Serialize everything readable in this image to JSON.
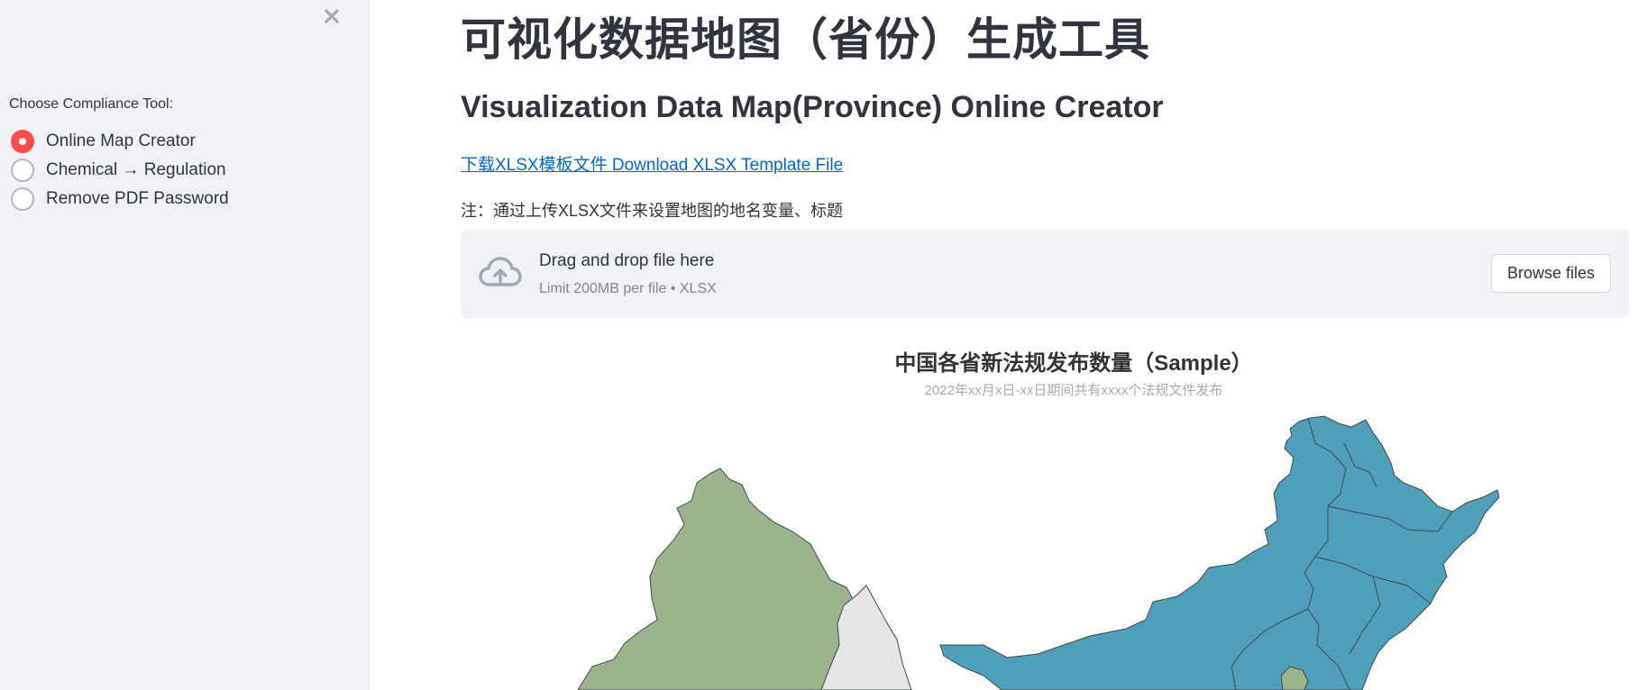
{
  "sidebar": {
    "radio_label": "Choose Compliance Tool:",
    "options": [
      {
        "label": "Online Map Creator",
        "selected": true
      },
      {
        "label": "Chemical → Regulation",
        "selected": false
      },
      {
        "label": "Remove PDF Password",
        "selected": false
      }
    ]
  },
  "main": {
    "title_cn": "可视化数据地图（省份）生成工具",
    "title_en": "Visualization Data Map(Province) Online Creator",
    "download_link": "下载XLSX模板文件 Download XLSX Template File",
    "note": "注：通过上传XLSX文件来设置地图的地名变量、标题",
    "uploader": {
      "title": "Drag and drop file here",
      "limit": "Limit 200MB per file • XLSX",
      "browse_label": "Browse files"
    },
    "chart": {
      "title": "中国各省新法规发布数量（Sample）",
      "subtitle": "2022年xx月x日-xx日期间共有xxxx个法规文件发布"
    }
  },
  "colors": {
    "accent": "#ff4b4b",
    "link": "#0068c9",
    "sidebar_bg": "#f0f2f6",
    "map_blue": "#4f9fba",
    "map_green": "#9cb38e",
    "map_gray": "#e6e6e6"
  }
}
